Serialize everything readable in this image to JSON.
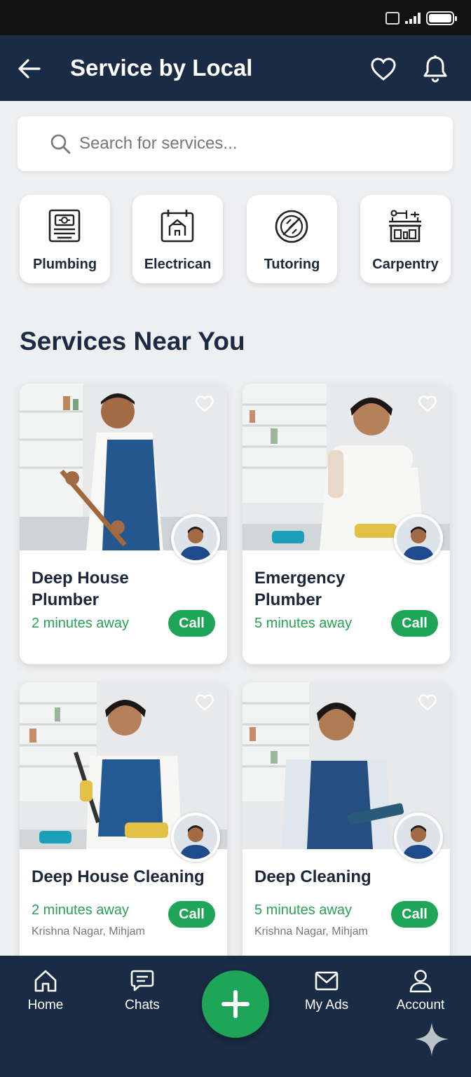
{
  "header": {
    "title": "Service by Local",
    "back_icon": "arrow-left-icon",
    "favorites_icon": "heart-icon",
    "notifications_icon": "bell-icon"
  },
  "search": {
    "placeholder": "Search for services..."
  },
  "categories": [
    {
      "label": "Plumbing",
      "icon": "plumbing-icon"
    },
    {
      "label": "Electrican",
      "icon": "electrician-icon"
    },
    {
      "label": "Tutoring",
      "icon": "tutoring-icon"
    },
    {
      "label": "Carpentry",
      "icon": "carpentry-icon"
    }
  ],
  "section": {
    "title": "Services Near You"
  },
  "listings": [
    {
      "title_line1": "Deep House",
      "title_line2": "Plumber",
      "distance": "2 minutes away",
      "call_label": "Call"
    },
    {
      "title_line1": "Emergency",
      "title_line2": "Plumber",
      "distance": "5 minutes away",
      "call_label": "Call"
    },
    {
      "title": "Deep House Cleaning",
      "distance": "2 minutes away",
      "location": "Krishna Nagar, Mihjam",
      "call_label": "Call"
    },
    {
      "title": "Deep Cleaning",
      "distance": "5 minutes away",
      "location": "Krishna Nagar, Mihjam",
      "call_label": "Call"
    }
  ],
  "bottom_nav": {
    "items": [
      {
        "label": "Home",
        "icon": "home-icon"
      },
      {
        "label": "Chats",
        "icon": "chat-icon"
      },
      {
        "label": "My Ads",
        "icon": "mail-icon"
      },
      {
        "label": "Account",
        "icon": "user-icon"
      }
    ],
    "fab_icon": "plus-icon"
  },
  "colors": {
    "navy": "#1a2b45",
    "green": "#1fa557",
    "background": "#eeeff1"
  }
}
